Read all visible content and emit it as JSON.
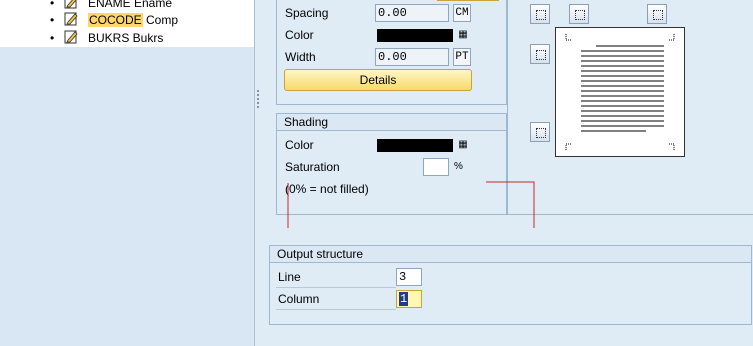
{
  "tree": {
    "items": [
      {
        "label": "ENAME Ename",
        "highlight": "",
        "rest": ""
      },
      {
        "label": "",
        "highlight": "COCODE",
        "rest": " Comp"
      },
      {
        "label": "BUKRS Bukrs",
        "highlight": "",
        "rest": ""
      }
    ],
    "icon": "pencil-icon",
    "bullet": "•"
  },
  "frame": {
    "spacing_label": "Spacing",
    "spacing_value": "0.00",
    "spacing_unit": "CM",
    "color_label": "Color",
    "color_value_hex": "#000000",
    "width_label": "Width",
    "width_value": "0.00",
    "width_unit": "PT",
    "details_label": "Details"
  },
  "shading": {
    "title": "Shading",
    "color_label": "Color",
    "color_value_hex": "#000000",
    "saturation_label": "Saturation",
    "saturation_value": "",
    "saturation_unit": "%",
    "note": "(0% = not filled)"
  },
  "output_structure": {
    "title": "Output structure",
    "line_label": "Line",
    "line_value": "3",
    "column_label": "Column",
    "column_value": "1"
  },
  "colors": {
    "highlight": "#ffd66b",
    "annotation_red": "#c0282d",
    "button_yellow": "#f6da6a"
  }
}
